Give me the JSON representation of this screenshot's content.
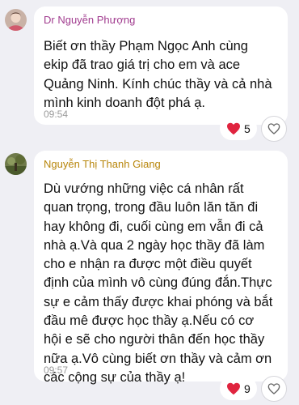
{
  "messages": [
    {
      "sender": "Dr Nguyễn Phượng",
      "sender_color": "#a13c8f",
      "text": "Biết ơn thầy Phạm Ngọc Anh cùng\nekip đã trao giá trị cho em và ace\nQuảng Ninh. Kính chúc thầy và cả nhà\nmình kinh doanh đột phá ạ.",
      "time": "09:54",
      "reaction_icon": "heart-icon",
      "reaction_count": "5"
    },
    {
      "sender": "Nguyễn Thị Thanh Giang",
      "sender_color": "#b8860b",
      "text": "Dù vướng những việc cá nhân rất\nquan trọng, trong đầu luôn lăn tăn đi\nhay không đi, cuối cùng em vẫn đi cả\nnhà ạ.Và qua 2 ngày học thầy đã làm\ncho e nhận ra được một điều quyết\nđịnh của mình vô cùng đúng đắn.Thực\nsự e cảm thấy được khai phóng và bắt\nđầu mê được học thầy ạ.Nếu có cơ\nhội e sẽ cho người thân đến học thầy\nnữa ạ.Vô cùng biết ơn thầy và cảm ơn\ncác cộng sự của thầy ạ!",
      "time": "09:57",
      "reaction_icon": "heart-icon",
      "reaction_count": "9"
    }
  ],
  "colors": {
    "background": "#efeff4",
    "bubble": "#ffffff",
    "heart": "#e0243f"
  }
}
